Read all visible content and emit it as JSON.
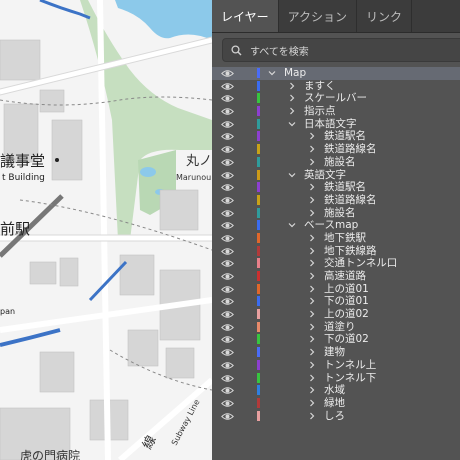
{
  "tabs": [
    "レイヤー",
    "アクション",
    "リンク"
  ],
  "active_tab": 0,
  "search": {
    "placeholder": "すべてを検索"
  },
  "layers": [
    {
      "name": "Map",
      "depth": 0,
      "expanded": true,
      "color": "#4a6cf7",
      "selected": true
    },
    {
      "name": "ますく",
      "depth": 1,
      "expanded": false,
      "color": "#3b6cf0"
    },
    {
      "name": "スケールバー",
      "depth": 1,
      "expanded": false,
      "color": "#37c53f"
    },
    {
      "name": "指示点",
      "depth": 1,
      "expanded": false,
      "color": "#8d3fd0"
    },
    {
      "name": "日本語文字",
      "depth": 1,
      "expanded": true,
      "color": "#2f9c9c"
    },
    {
      "name": "鉄道駅名",
      "depth": 2,
      "expanded": false,
      "color": "#8d3fd0"
    },
    {
      "name": "鉄道路線名",
      "depth": 2,
      "expanded": false,
      "color": "#c8a218"
    },
    {
      "name": "施設名",
      "depth": 2,
      "expanded": false,
      "color": "#2f9c9c"
    },
    {
      "name": "英語文字",
      "depth": 1,
      "expanded": true,
      "color": "#cc9a18"
    },
    {
      "name": "鉄道駅名",
      "depth": 2,
      "expanded": false,
      "color": "#8d3fd0"
    },
    {
      "name": "鉄道路線名",
      "depth": 2,
      "expanded": false,
      "color": "#c8a218"
    },
    {
      "name": "施設名",
      "depth": 2,
      "expanded": false,
      "color": "#2f9c9c"
    },
    {
      "name": "ベースmap",
      "depth": 1,
      "expanded": true,
      "color": "#3b6cf0"
    },
    {
      "name": "地下鉄駅",
      "depth": 2,
      "expanded": false,
      "color": "#e0672a"
    },
    {
      "name": "地下鉄線路",
      "depth": 2,
      "expanded": false,
      "color": "#b23a3a"
    },
    {
      "name": "交通トンネル口",
      "depth": 2,
      "expanded": false,
      "color": "#e8808a"
    },
    {
      "name": "高速道路",
      "depth": 2,
      "expanded": false,
      "color": "#cc2f2f"
    },
    {
      "name": "上の道01",
      "depth": 2,
      "expanded": false,
      "color": "#e0672a"
    },
    {
      "name": "下の道01",
      "depth": 2,
      "expanded": false,
      "color": "#3b6cf0"
    },
    {
      "name": "上の道02",
      "depth": 2,
      "expanded": false,
      "color": "#e8a0a0"
    },
    {
      "name": "道塗り",
      "depth": 2,
      "expanded": false,
      "color": "#e88a6a"
    },
    {
      "name": "下の道02",
      "depth": 2,
      "expanded": false,
      "color": "#37c53f"
    },
    {
      "name": "建物",
      "depth": 2,
      "expanded": false,
      "color": "#4a6cf7"
    },
    {
      "name": "トンネル上",
      "depth": 2,
      "expanded": false,
      "color": "#8d3fd0"
    },
    {
      "name": "トンネル下",
      "depth": 2,
      "expanded": false,
      "color": "#37c53f"
    },
    {
      "name": "水域",
      "depth": 2,
      "expanded": false,
      "color": "#2f7fe0"
    },
    {
      "name": "緑地",
      "depth": 2,
      "expanded": false,
      "color": "#b23a3a"
    },
    {
      "name": "しろ",
      "depth": 2,
      "expanded": false,
      "color": "#e8a0a0"
    }
  ],
  "map_labels": {
    "building_jp": "議事堂",
    "building_en": "t Building",
    "station_jp": "前駅",
    "station_en": "pan",
    "marunouchi_jp": "丸ノ",
    "marunouchi_en": "Marunou",
    "line_jp": "線",
    "line_en": "Subway Line",
    "bottom_jp": "虎の門病院"
  },
  "colors": {
    "panel_bg": "#535353",
    "tab_bar": "#3c3c3c",
    "selected_row": "#666a73",
    "water": "#8cc9ea",
    "green": "#c6dfc0",
    "building": "#d4d4d4",
    "rail": "#3c73c6"
  }
}
